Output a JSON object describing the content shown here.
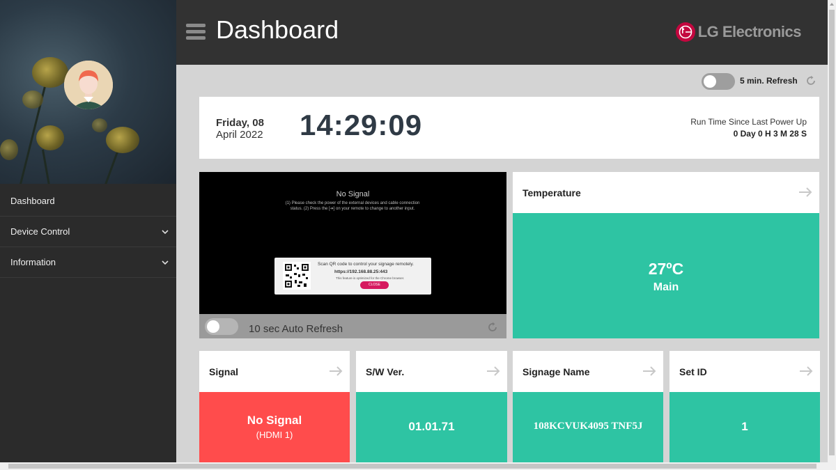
{
  "sidebar": {
    "items": [
      {
        "label": "Dashboard"
      },
      {
        "label": "Device Control"
      },
      {
        "label": "Information"
      }
    ]
  },
  "header": {
    "title": "Dashboard",
    "brand": "LG Electronics"
  },
  "refresh": {
    "label": "5 min. Refresh"
  },
  "datetime": {
    "day": "Friday, 08",
    "month_year": "April 2022",
    "time": "14:29:09",
    "runtime_label": "Run Time Since Last Power Up",
    "runtime_value": "0 Day 0 H 3 M 28 S"
  },
  "screen": {
    "no_signal_title": "No Signal",
    "no_signal_msg": "(1) Please check the power of the external devices and cable connection status. (2) Press the [➔] on your remote to change to another input.",
    "qr_text": "Scan QR code to control your signage remotely.",
    "qr_url": "https://192.168.88.25:443",
    "qr_note": "This feature is optimized for the Chrome browser.",
    "qr_close": "CLOSE",
    "auto_refresh_label": "10 sec Auto Refresh"
  },
  "temperature": {
    "title": "Temperature",
    "value": "27ºC",
    "sub": "Main"
  },
  "tiles": {
    "signal": {
      "title": "Signal",
      "value": "No Signal",
      "sub": "(HDMI 1)"
    },
    "sw": {
      "title": "S/W Ver.",
      "value": "01.01.71"
    },
    "signage": {
      "title": "Signage Name",
      "value": "108KCVUK4095 TNF5J"
    },
    "setid": {
      "title": "Set ID",
      "value": "1"
    }
  },
  "colors": {
    "teal": "#2ec4a3",
    "red": "#ff4c4c",
    "header": "#323232",
    "sidebar": "#2b2b2b",
    "brand": "#c3073f"
  },
  "icons": [
    "menu-icon",
    "lg-logo-icon",
    "chevron-down-icon",
    "refresh-icon",
    "arrow-right-icon",
    "qr-code-icon",
    "avatar"
  ]
}
